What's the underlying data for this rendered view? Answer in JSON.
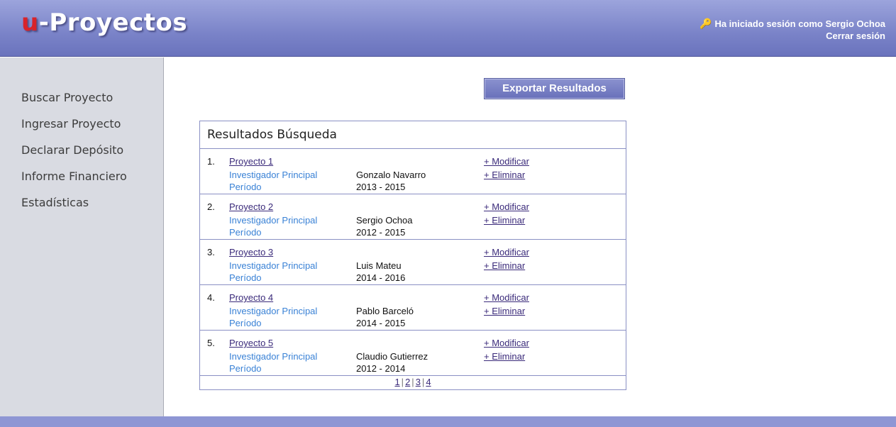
{
  "header": {
    "logo_u": "u",
    "logo_rest": "-Proyectos",
    "session_text": "Ha iniciado sesión como Sergio Ochoa",
    "logout_label": "Cerrar sesión",
    "icon": "key-icon"
  },
  "sidebar": {
    "items": [
      {
        "label": "Buscar Proyecto"
      },
      {
        "label": "Ingresar Proyecto"
      },
      {
        "label": "Declarar Depósito"
      },
      {
        "label": "Informe Financiero"
      },
      {
        "label": "Estadísticas"
      }
    ]
  },
  "export_label": "Exportar Resultados",
  "results": {
    "title": "Resultados Búsqueda",
    "investigator_label": "Investigador Principal",
    "period_label": "Período",
    "modify_label": "+ Modificar",
    "delete_label": "+ Eliminar",
    "rows": [
      {
        "num": "1.",
        "name": "Proyecto 1",
        "investigator": "Gonzalo Navarro",
        "period": "2013 - 2015"
      },
      {
        "num": "2.",
        "name": "Proyecto 2",
        "investigator": "Sergio Ochoa",
        "period": "2012 - 2015"
      },
      {
        "num": "3.",
        "name": "Proyecto 3",
        "investigator": "Luis Mateu",
        "period": "2014 - 2016"
      },
      {
        "num": "4.",
        "name": "Proyecto 4",
        "investigator": "Pablo Barceló",
        "period": "2014 - 2015"
      },
      {
        "num": "5.",
        "name": "Proyecto 5",
        "investigator": "Claudio Gutierrez",
        "period": "2012 - 2014"
      }
    ]
  },
  "pagination": {
    "pages": [
      "1",
      "2",
      "3",
      "4"
    ],
    "separator": "|"
  },
  "colors": {
    "header": "#7a83c8",
    "sidebar": "#d9dbe2",
    "link": "#3a2a7a",
    "label": "#3a82d6",
    "logo_accent": "#d8232a"
  }
}
